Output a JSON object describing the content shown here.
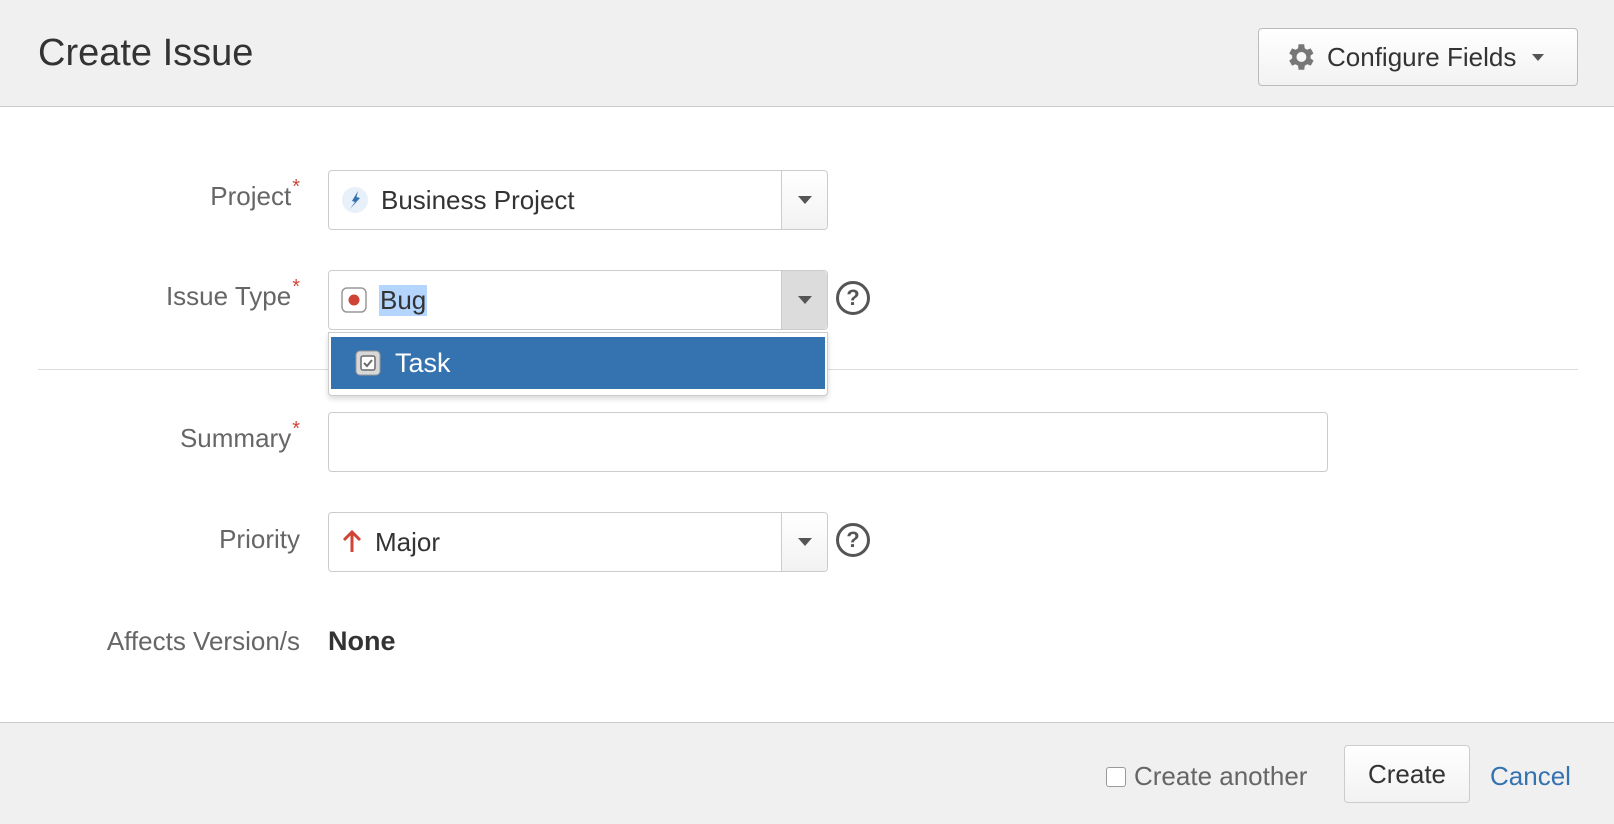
{
  "dialog": {
    "title": "Create Issue",
    "configure_fields_label": "Configure Fields"
  },
  "fields": {
    "project": {
      "label": "Project",
      "required": "*",
      "value": "Business Project",
      "icon": "rocket-icon"
    },
    "issue_type": {
      "label": "Issue Type",
      "required": "*",
      "value": "Bug",
      "icon": "bug-icon",
      "help": "?"
    },
    "issue_type_dropdown": {
      "options": [
        {
          "label": "Task",
          "icon": "task-icon",
          "highlighted": true
        }
      ]
    },
    "summary": {
      "label": "Summary",
      "required": "*",
      "value": ""
    },
    "priority": {
      "label": "Priority",
      "value": "Major",
      "icon": "arrow-up-icon",
      "help": "?"
    },
    "affects_versions": {
      "label": "Affects Version/s",
      "value": "None"
    }
  },
  "footer": {
    "create_another_label": "Create another",
    "create_another_checked": false,
    "create_label": "Create",
    "cancel_label": "Cancel"
  },
  "colors": {
    "header_bg": "#f0f0f0",
    "highlight_blue": "#3572b0",
    "required_red": "#d04437",
    "link_blue": "#3572b0"
  }
}
